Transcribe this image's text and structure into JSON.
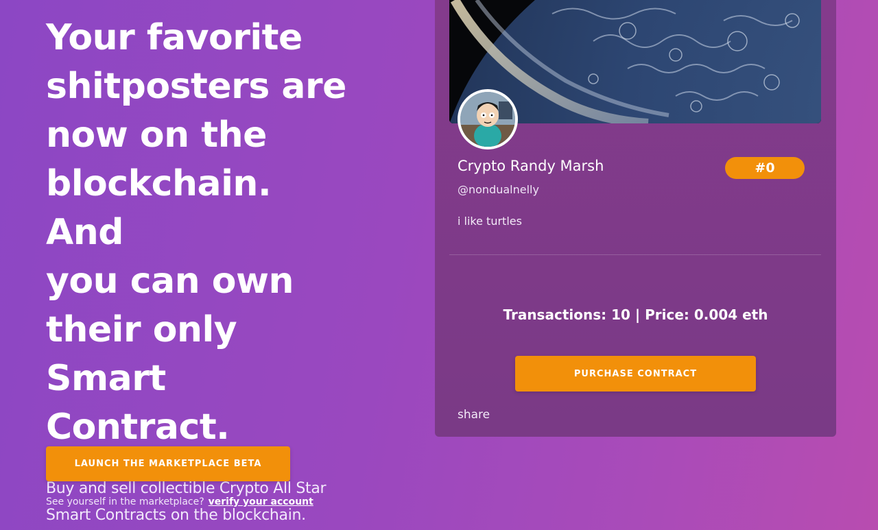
{
  "hero": {
    "headline_lines": [
      "Your favorite",
      "shitposters are",
      "now on the",
      "blockchain. And",
      "you can own",
      "their only Smart",
      "Contract."
    ],
    "subhead_lines": [
      "Buy and sell collectible Crypto All Star",
      "Smart Contracts on the blockchain."
    ],
    "launch_button": "LAUNCH THE MARKETPLACE BETA",
    "verify_prompt": "See yourself in the marketplace?",
    "verify_link": "verify your account"
  },
  "card": {
    "name": "Crypto Randy Marsh",
    "rank": "#0",
    "handle": "@nondualnelly",
    "bio": "i like turtles",
    "stats": "Transactions: 10 | Price: 0.004 eth",
    "purchase_button": "PURCHASE CONTRACT",
    "share_label": "share"
  },
  "colors": {
    "accent": "#f2900a",
    "card_bg": "#7d3a8a",
    "page_gradient_start": "#8c47c4",
    "page_gradient_end": "#b84cb0"
  }
}
